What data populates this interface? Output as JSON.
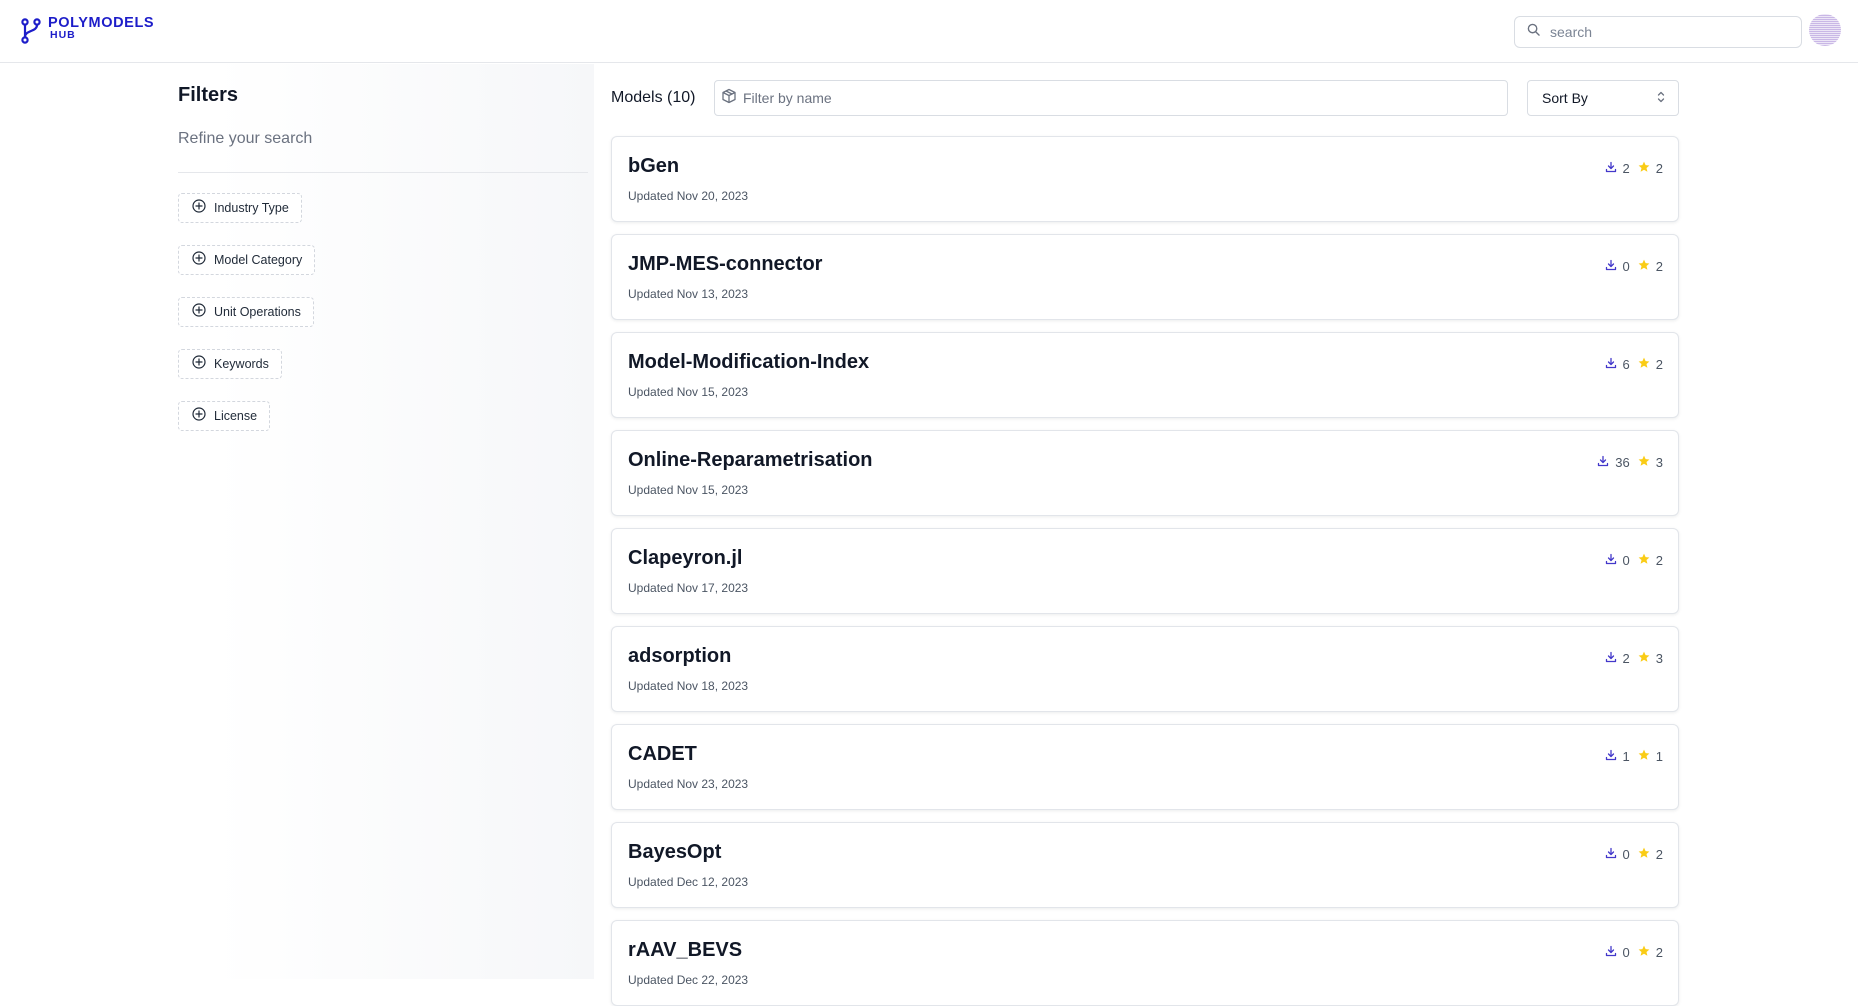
{
  "header": {
    "logo_line1": "POLYMODELS",
    "logo_line2": "HUB",
    "search_placeholder": "search"
  },
  "sidebar": {
    "title": "Filters",
    "subtitle": "Refine your search",
    "filters": [
      {
        "label": "Industry Type"
      },
      {
        "label": "Model Category"
      },
      {
        "label": "Unit Operations"
      },
      {
        "label": "Keywords"
      },
      {
        "label": "License"
      }
    ]
  },
  "main": {
    "models_count_label": "Models (10)",
    "filter_placeholder": "Filter by name",
    "sort_label": "Sort By",
    "models": [
      {
        "name": "bGen",
        "updated": "Updated Nov 20, 2023",
        "downloads": "2",
        "stars": "2"
      },
      {
        "name": "JMP-MES-connector",
        "updated": "Updated Nov 13, 2023",
        "downloads": "0",
        "stars": "2"
      },
      {
        "name": "Model-Modification-Index",
        "updated": "Updated Nov 15, 2023",
        "downloads": "6",
        "stars": "2"
      },
      {
        "name": "Online-Reparametrisation",
        "updated": "Updated Nov 15, 2023",
        "downloads": "36",
        "stars": "3"
      },
      {
        "name": "Clapeyron.jl",
        "updated": "Updated Nov 17, 2023",
        "downloads": "0",
        "stars": "2"
      },
      {
        "name": "adsorption",
        "updated": "Updated Nov 18, 2023",
        "downloads": "2",
        "stars": "3"
      },
      {
        "name": "CADET",
        "updated": "Updated Nov 23, 2023",
        "downloads": "1",
        "stars": "1"
      },
      {
        "name": "BayesOpt",
        "updated": "Updated Dec 12, 2023",
        "downloads": "0",
        "stars": "2"
      },
      {
        "name": "rAAV_BEVS",
        "updated": "Updated Dec 22, 2023",
        "downloads": "0",
        "stars": "2"
      }
    ]
  },
  "colors": {
    "brand": "#1d1dc9",
    "download_icon": "#4338ca",
    "star": "#facc15"
  },
  "icons": {
    "logo": "branch-icon",
    "search": "search-icon",
    "filter_add": "plus-circle-icon",
    "filter_name": "cube-icon",
    "sort": "chevron-up-down-icon",
    "downloads": "download-icon",
    "stars": "star-icon"
  }
}
